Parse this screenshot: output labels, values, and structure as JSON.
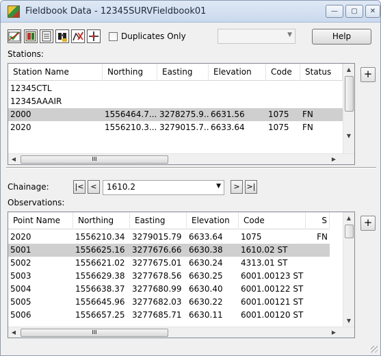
{
  "window": {
    "title": "Fieldbook Data - 12345SURVFieldbook01",
    "minimize_glyph": "—",
    "maximize_glyph": "▢",
    "close_glyph": "✕"
  },
  "toolbar": {
    "icons": [
      "edit-checkmark-icon",
      "fieldbook-icon",
      "list-icon",
      "binoculars-icon",
      "traverse-icon",
      "point-cross-icon"
    ],
    "duplicates_label": "Duplicates Only",
    "duplicates_checked": false,
    "filter_value": "",
    "help_label": "Help"
  },
  "stations": {
    "label": "Stations:",
    "columns": [
      "Station Name",
      "Northing",
      "Easting",
      "Elevation",
      "Code",
      "Status"
    ],
    "rows": [
      [
        "12345CTL",
        "",
        "",
        "",
        "",
        ""
      ],
      [
        "12345AAAIR",
        "",
        "",
        "",
        "",
        ""
      ],
      [
        "2000",
        "1556464.7...",
        "3278275.9...",
        "6631.56",
        "1075",
        "FN"
      ],
      [
        "2020",
        "1556210.3...",
        "3279015.7...",
        "6633.64",
        "1075",
        "FN"
      ]
    ],
    "selected_index": 2,
    "side_button_glyph": "+",
    "hscroll_thumb_glyph": "III"
  },
  "chainage": {
    "label": "Chainage:",
    "value": "1610.2",
    "first_glyph": "|<",
    "prev_glyph": "<",
    "next_glyph": ">",
    "last_glyph": ">|"
  },
  "observations": {
    "label": "Observations:",
    "columns": [
      "Point Name",
      "Northing",
      "Easting",
      "Elevation",
      "Code",
      "S"
    ],
    "rows": [
      [
        "2020",
        "1556210.34",
        "3279015.79",
        "6633.64",
        "1075",
        "FN"
      ],
      [
        "5001",
        "1556625.16",
        "3277676.66",
        "6630.38",
        "1610.02 ST",
        ""
      ],
      [
        "5002",
        "1556621.02",
        "3277675.01",
        "6630.24",
        "4313.01 ST",
        ""
      ],
      [
        "5003",
        "1556629.38",
        "3277678.56",
        "6630.25",
        "6001.00123 ST",
        ""
      ],
      [
        "5004",
        "1556638.37",
        "3277680.99",
        "6630.40",
        "6001.00122 ST",
        ""
      ],
      [
        "5005",
        "1556645.96",
        "3277682.03",
        "6630.22",
        "6001.00121 ST",
        ""
      ],
      [
        "5006",
        "1556657.25",
        "3277685.71",
        "6630.11",
        "6001.00120 ST",
        ""
      ]
    ],
    "selected_index": 1,
    "side_button_glyph": "+",
    "hscroll_thumb_glyph": "III"
  }
}
